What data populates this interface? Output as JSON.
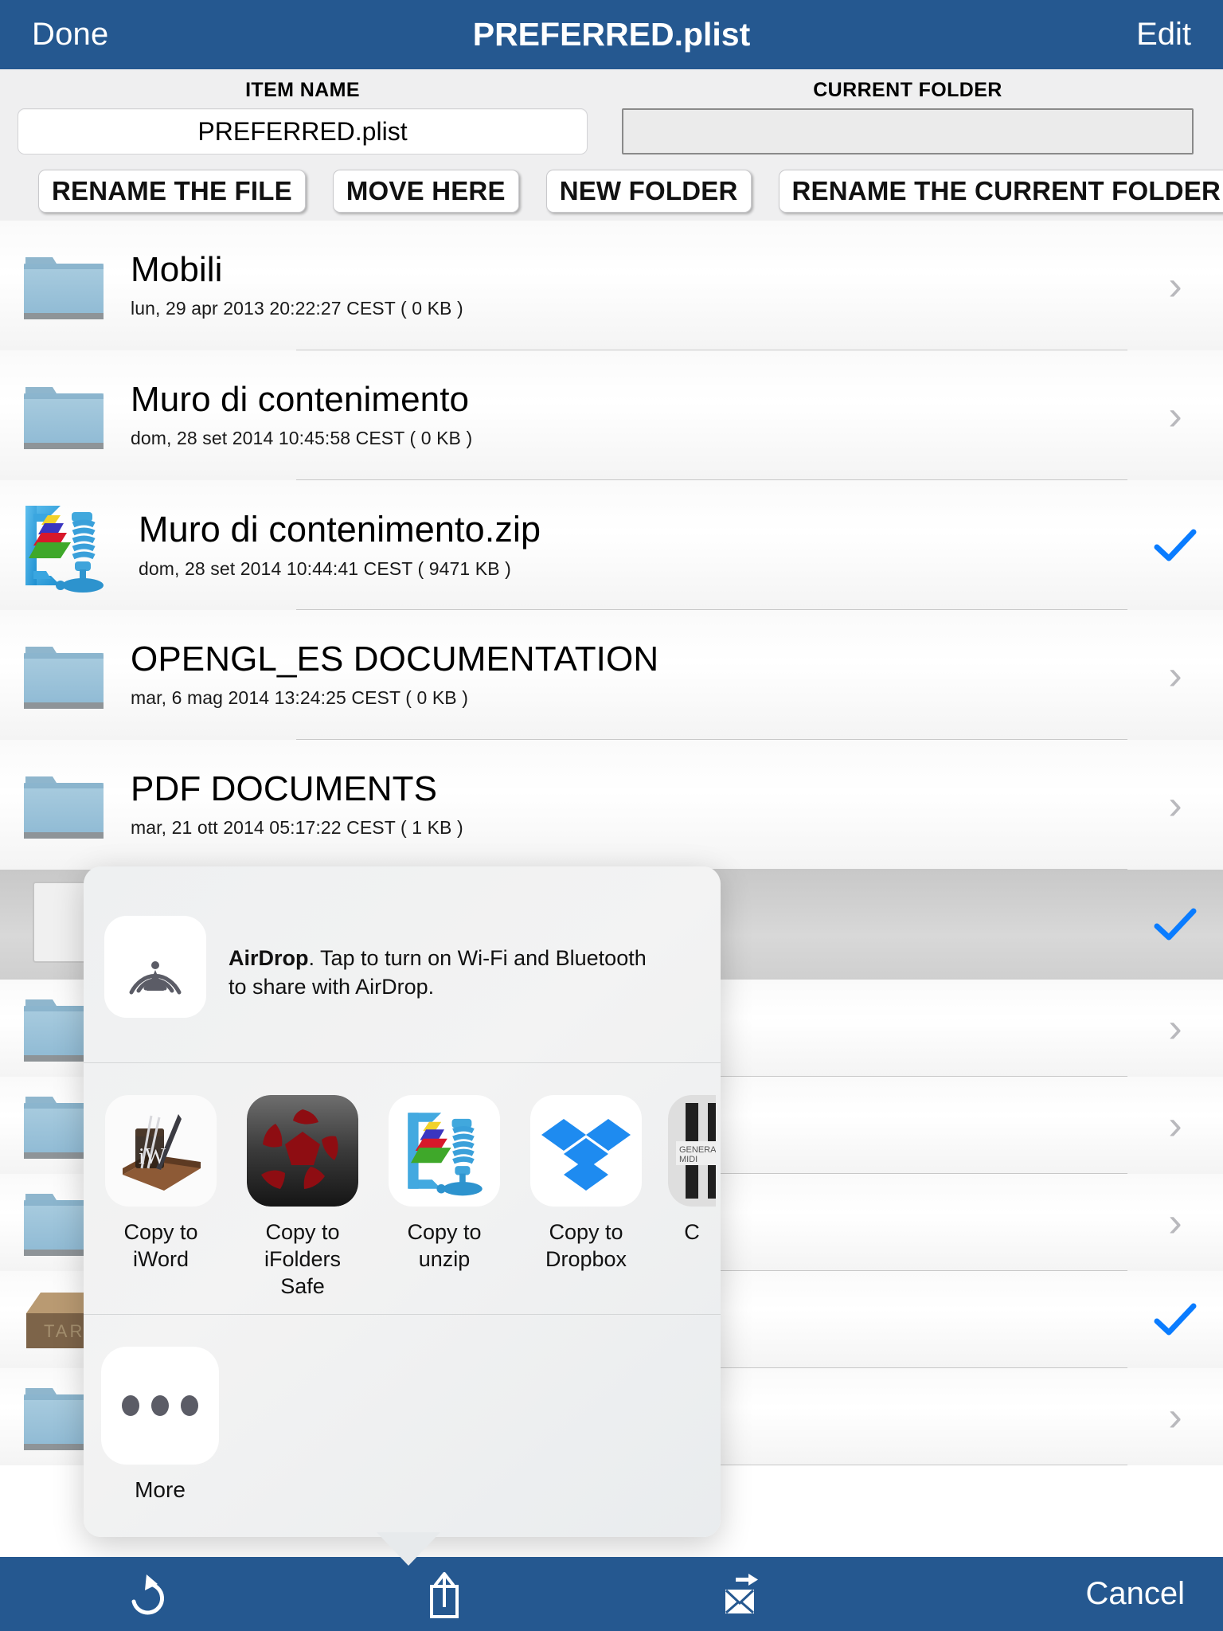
{
  "navbar": {
    "done_label": "Done",
    "title": "PREFERRED.plist",
    "edit_label": "Edit",
    "bar_color": "#255890"
  },
  "fields": {
    "item_name_label": "ITEM NAME",
    "current_folder_label": "CURRENT FOLDER",
    "item_name_value": "PREFERRED.plist",
    "current_folder_value": ""
  },
  "actions": {
    "rename_file": "RENAME THE FILE",
    "move_here": "MOVE HERE",
    "new_folder": "NEW FOLDER",
    "rename_current_folder": "RENAME THE CURRENT FOLDER",
    "up_folder_icon": "folder-up-icon"
  },
  "filelist": {
    "rows": [
      {
        "name": "Mobili",
        "meta": "lun, 29 apr 2013 20:22:27 CEST ( 0 KB )",
        "icon": "folder-icon",
        "accessory": "chevron-right-icon",
        "selected": false
      },
      {
        "name": "Muro di contenimento",
        "meta": "dom, 28 set 2014 10:45:58 CEST ( 0 KB )",
        "icon": "folder-icon",
        "accessory": "chevron-right-icon",
        "selected": false
      },
      {
        "name": "Muro di contenimento.zip",
        "meta": "dom, 28 set 2014 10:44:41 CEST ( 9471 KB )",
        "icon": "zip-clamp-icon",
        "accessory": "checkmark-icon",
        "selected": false
      },
      {
        "name": "OPENGL_ES DOCUMENTATION",
        "meta": "mar, 6 mag 2014 13:24:25 CEST ( 0 KB )",
        "icon": "folder-icon",
        "accessory": "chevron-right-icon",
        "selected": false
      },
      {
        "name": "PDF DOCUMENTS",
        "meta": "mar, 21 ott 2014 05:17:22 CEST ( 1 KB )",
        "icon": "folder-icon",
        "accessory": "chevron-right-icon",
        "selected": false
      },
      {
        "name": "",
        "meta": "",
        "icon": "plist-file-icon",
        "accessory": "checkmark-icon",
        "selected": true
      },
      {
        "name": "",
        "meta": "",
        "icon": "folder-icon",
        "accessory": "chevron-right-icon",
        "selected": false
      },
      {
        "name": "",
        "meta": "",
        "icon": "folder-icon",
        "accessory": "chevron-right-icon",
        "selected": false
      },
      {
        "name": "",
        "meta": "",
        "icon": "folder-icon",
        "accessory": "chevron-right-icon",
        "selected": false
      },
      {
        "name": "",
        "meta": "",
        "icon": "tar-box-icon",
        "accessory": "checkmark-icon",
        "selected": false
      },
      {
        "name": "",
        "meta": "",
        "icon": "folder-icon",
        "accessory": "chevron-right-icon",
        "selected": false
      }
    ],
    "checkmark_color": "#0a7cff",
    "chevron_color": "#b9b9bd"
  },
  "share_sheet": {
    "airdrop": {
      "title": "AirDrop",
      "message": ". Tap to turn on Wi-Fi and Bluetooth to share with AirDrop.",
      "icon": "airdrop-icon"
    },
    "apps": [
      {
        "label": "Copy to iWord",
        "icon": "iword-icon"
      },
      {
        "label": "Copy to iFolders Safe",
        "icon": "ifolders-safe-icon"
      },
      {
        "label": "Copy to unzip",
        "icon": "unzip-icon"
      },
      {
        "label": "Copy to Dropbox",
        "icon": "dropbox-icon"
      },
      {
        "label": "C",
        "icon": "midi-app-icon"
      }
    ],
    "more": {
      "label": "More",
      "icon": "ellipsis-icon"
    }
  },
  "toolbar": {
    "refresh_icon": "refresh-icon",
    "share_icon": "share-icon",
    "mail_forward_icon": "mail-forward-icon",
    "cancel_label": "Cancel",
    "bar_color": "#255890"
  }
}
